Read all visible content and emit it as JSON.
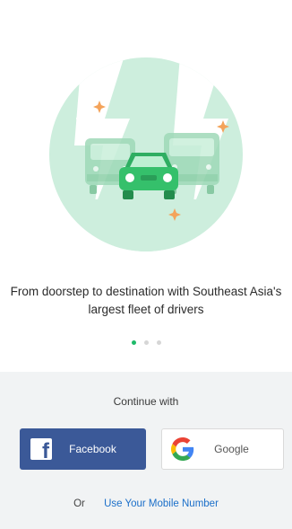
{
  "onboarding": {
    "tagline_line1": "From doorstep to destination with Southeast Asia's",
    "tagline_line2": "largest fleet of drivers",
    "pager": {
      "count": 3,
      "active_index": 0
    },
    "illustration_icon": "cars-lightning-illustration"
  },
  "login": {
    "continue_with": "Continue with",
    "facebook_label": "Facebook",
    "google_label": "Google",
    "or_text": "Or",
    "mobile_link": "Use Your Mobile Number"
  },
  "colors": {
    "facebook_blue": "#3b5998",
    "brand_green": "#1fba6a",
    "link_blue": "#1b6fc9",
    "bottom_bg": "#f1f3f4"
  }
}
